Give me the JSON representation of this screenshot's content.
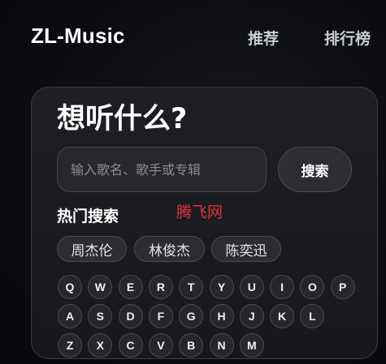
{
  "header": {
    "brand": "ZL-Music",
    "nav": [
      "推荐",
      "排行榜"
    ]
  },
  "search": {
    "headline": "想听什么?",
    "placeholder": "输入歌名、歌手或专辑",
    "button_label": "搜索"
  },
  "hot": {
    "title": "热门搜索",
    "chips": [
      "周杰伦",
      "林俊杰",
      "陈奕迅"
    ]
  },
  "watermark": "腾飞网",
  "keyboard": {
    "row1": [
      "Q",
      "W",
      "E",
      "R",
      "T",
      "Y",
      "U",
      "I",
      "O",
      "P"
    ],
    "row2": [
      "A",
      "S",
      "D",
      "F",
      "G",
      "H",
      "J",
      "K",
      "L"
    ],
    "row3": [
      "Z",
      "X",
      "C",
      "V",
      "B",
      "N",
      "M"
    ]
  },
  "colors": {
    "background": "#0b0c10",
    "card": "#1a1c20",
    "watermark": "#e0323a"
  }
}
